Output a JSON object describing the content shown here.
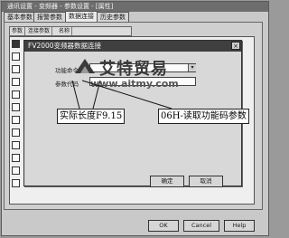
{
  "outer_window": {
    "title": "通讯设置 - 变频器 - 参数设置 - [属性]",
    "tabs": [
      "基本参数",
      "报警参数",
      "数据连接",
      "历史参数"
    ],
    "active_tab_index": 2,
    "inner_tabs": [
      "参数",
      "连接参数",
      "名称"
    ],
    "ok_label": "OK",
    "cancel_label": "Cancel",
    "help_label": "Help"
  },
  "dialog": {
    "title": "FV2000变频器数据连接",
    "close_glyph": "×",
    "fields": [
      {
        "label": "功能命令"
      },
      {
        "label": "参数代码"
      }
    ],
    "confirm_label": "确定",
    "cancel_label": "取消"
  },
  "annotations": {
    "actual_length": "实际长度F9.15",
    "read_function_code": "06H-读取功能码参数"
  },
  "watermark": {
    "brand": "艾特贸易",
    "url": "www.aitmy.com"
  },
  "colors": {
    "dialog_title_bg": "#3f3f3f",
    "callout_bg": "#ffffff"
  }
}
